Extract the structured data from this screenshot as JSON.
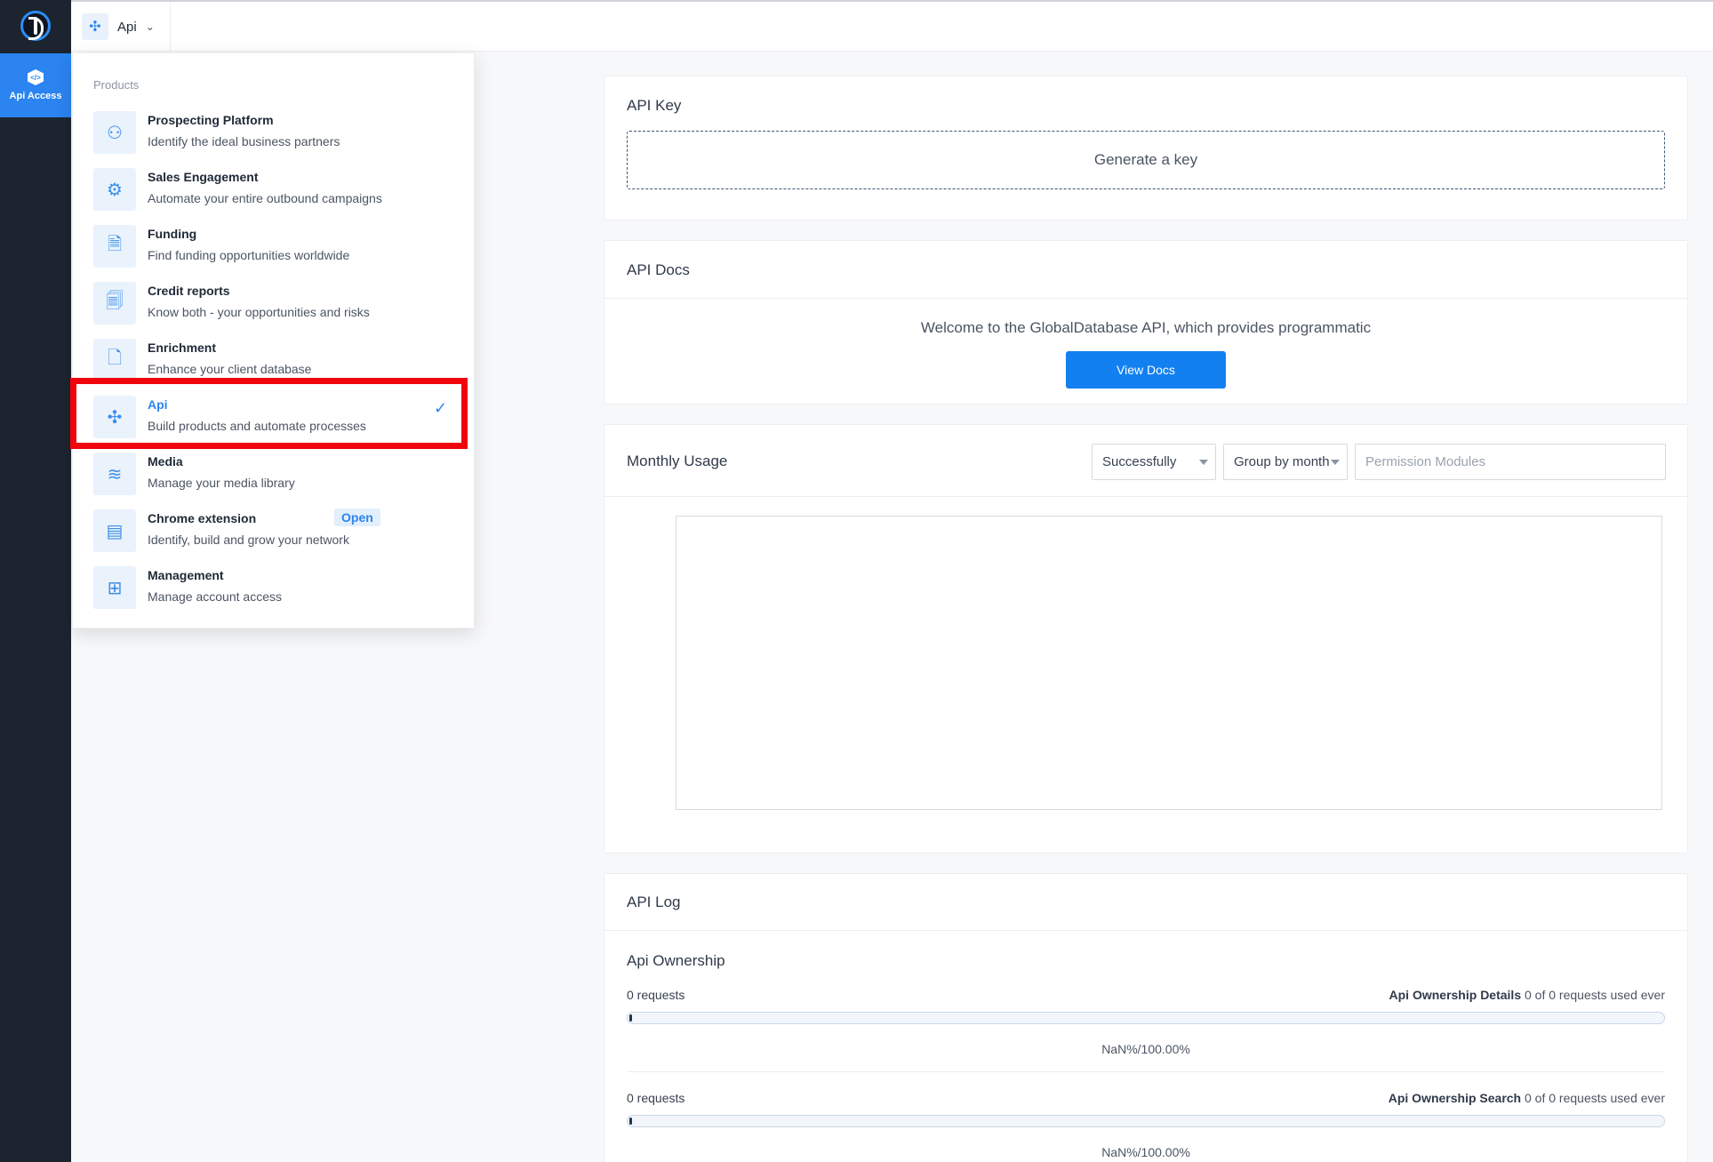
{
  "sidebar": {
    "active_label": "Api Access",
    "icon": "code-hex-icon"
  },
  "topbar": {
    "product_label": "Api",
    "icon": "api-icon"
  },
  "dropdown": {
    "heading": "Products",
    "items": [
      {
        "title": "Prospecting Platform",
        "subtitle": "Identify the ideal business partners",
        "icon": "prospecting-icon"
      },
      {
        "title": "Sales Engagement",
        "subtitle": "Automate your entire outbound campaigns",
        "icon": "sales-engagement-icon"
      },
      {
        "title": "Funding",
        "subtitle": "Find funding opportunities worldwide",
        "icon": "funding-icon"
      },
      {
        "title": "Credit reports",
        "subtitle": "Know both - your opportunities and risks",
        "icon": "credit-report-icon"
      },
      {
        "title": "Enrichment",
        "subtitle": "Enhance your client database",
        "icon": "enrichment-icon"
      },
      {
        "title": "Api",
        "subtitle": "Build products and automate processes",
        "icon": "api-icon",
        "active": true
      },
      {
        "title": "Media",
        "subtitle": "Manage your media library",
        "icon": "media-layers-icon"
      },
      {
        "title": "Chrome extension",
        "subtitle": "Identify, build and grow your network",
        "icon": "chrome-extension-icon",
        "badge": "Open"
      },
      {
        "title": "Management",
        "subtitle": "Manage account access",
        "icon": "management-grid-icon"
      }
    ]
  },
  "api_key": {
    "title": "API Key",
    "generate_label": "Generate a key"
  },
  "api_docs": {
    "title": "API Docs",
    "welcome_text": "Welcome to the GlobalDatabase API, which provides programmatic",
    "button_label": "View Docs"
  },
  "monthly_usage": {
    "title": "Monthly Usage",
    "status_select": "Successfully",
    "group_select": "Group by month",
    "modules_placeholder": "Permission Modules"
  },
  "api_log": {
    "title": "API Log",
    "section_title": "Api Ownership",
    "entries": [
      {
        "requests": "0 requests",
        "name": "Api Ownership Details",
        "usage": "0 of 0 requests used ever",
        "percent": "NaN%/100.00%"
      },
      {
        "requests": "0 requests",
        "name": "Api Ownership Search",
        "usage": "0 of 0 requests used ever",
        "percent": "NaN%/100.00%"
      }
    ]
  },
  "colors": {
    "accent": "#2b84f0",
    "sidebar_bg": "#1c2430",
    "highlight": "#f0050e"
  }
}
